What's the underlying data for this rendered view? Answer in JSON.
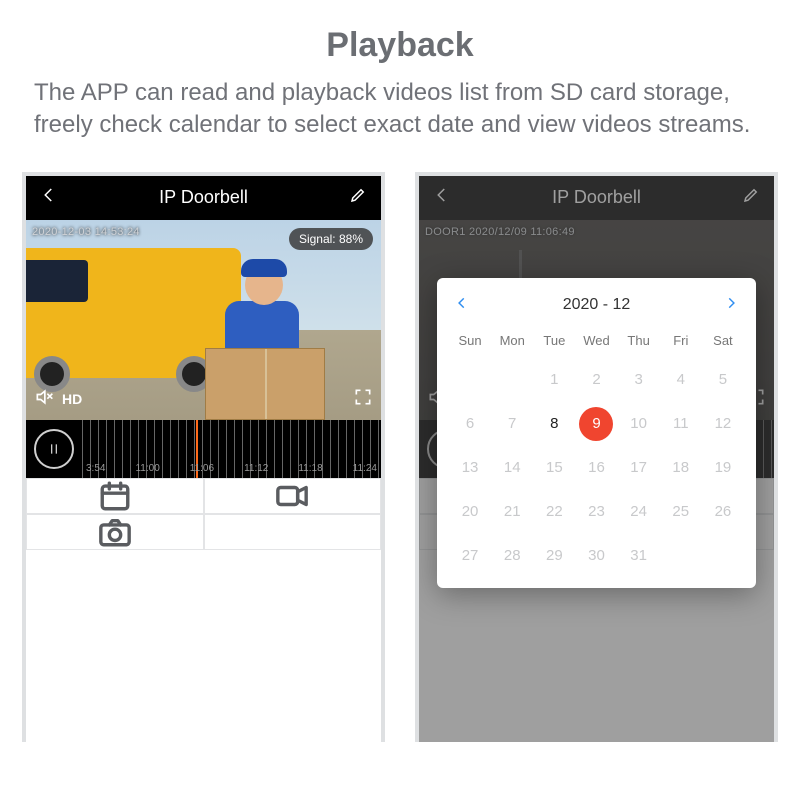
{
  "title": "Playback",
  "description": "The APP can read and playback videos list from SD card storage, freely check calendar to select exact date and view videos streams.",
  "left": {
    "header_title": "IP Doorbell",
    "timestamp": "2020-12-03  14:53:24",
    "signal_label": "Signal: 88%",
    "hd_label": "HD",
    "timeline_ticks": [
      "3:54",
      "11:00",
      "11:06",
      "11:12",
      "11:18",
      "11:24"
    ]
  },
  "right": {
    "header_title": "IP Doorbell",
    "timestamp": "DOOR1 2020/12/09  11:06:49",
    "calendar": {
      "month_label": "2020 - 12",
      "dow": [
        "Sun",
        "Mon",
        "Tue",
        "Wed",
        "Thu",
        "Fri",
        "Sat"
      ],
      "days": [
        {
          "n": "",
          "t": ""
        },
        {
          "n": "",
          "t": ""
        },
        {
          "n": "1",
          "t": "dim"
        },
        {
          "n": "2",
          "t": "dim"
        },
        {
          "n": "3",
          "t": "dim"
        },
        {
          "n": "4",
          "t": "dim"
        },
        {
          "n": "5",
          "t": "dim"
        },
        {
          "n": "6",
          "t": "dim"
        },
        {
          "n": "7",
          "t": "dim"
        },
        {
          "n": "8",
          "t": "live"
        },
        {
          "n": "9",
          "t": "sel"
        },
        {
          "n": "10",
          "t": "dim"
        },
        {
          "n": "11",
          "t": "dim"
        },
        {
          "n": "12",
          "t": "dim"
        },
        {
          "n": "13",
          "t": "dim"
        },
        {
          "n": "14",
          "t": "dim"
        },
        {
          "n": "15",
          "t": "dim"
        },
        {
          "n": "16",
          "t": "dim"
        },
        {
          "n": "17",
          "t": "dim"
        },
        {
          "n": "18",
          "t": "dim"
        },
        {
          "n": "19",
          "t": "dim"
        },
        {
          "n": "20",
          "t": "dim"
        },
        {
          "n": "21",
          "t": "dim"
        },
        {
          "n": "22",
          "t": "dim"
        },
        {
          "n": "23",
          "t": "dim"
        },
        {
          "n": "24",
          "t": "dim"
        },
        {
          "n": "25",
          "t": "dim"
        },
        {
          "n": "26",
          "t": "dim"
        },
        {
          "n": "27",
          "t": "dim"
        },
        {
          "n": "28",
          "t": "dim"
        },
        {
          "n": "29",
          "t": "dim"
        },
        {
          "n": "30",
          "t": "dim"
        },
        {
          "n": "31",
          "t": "dim"
        },
        {
          "n": "",
          "t": ""
        },
        {
          "n": "",
          "t": ""
        }
      ]
    }
  }
}
